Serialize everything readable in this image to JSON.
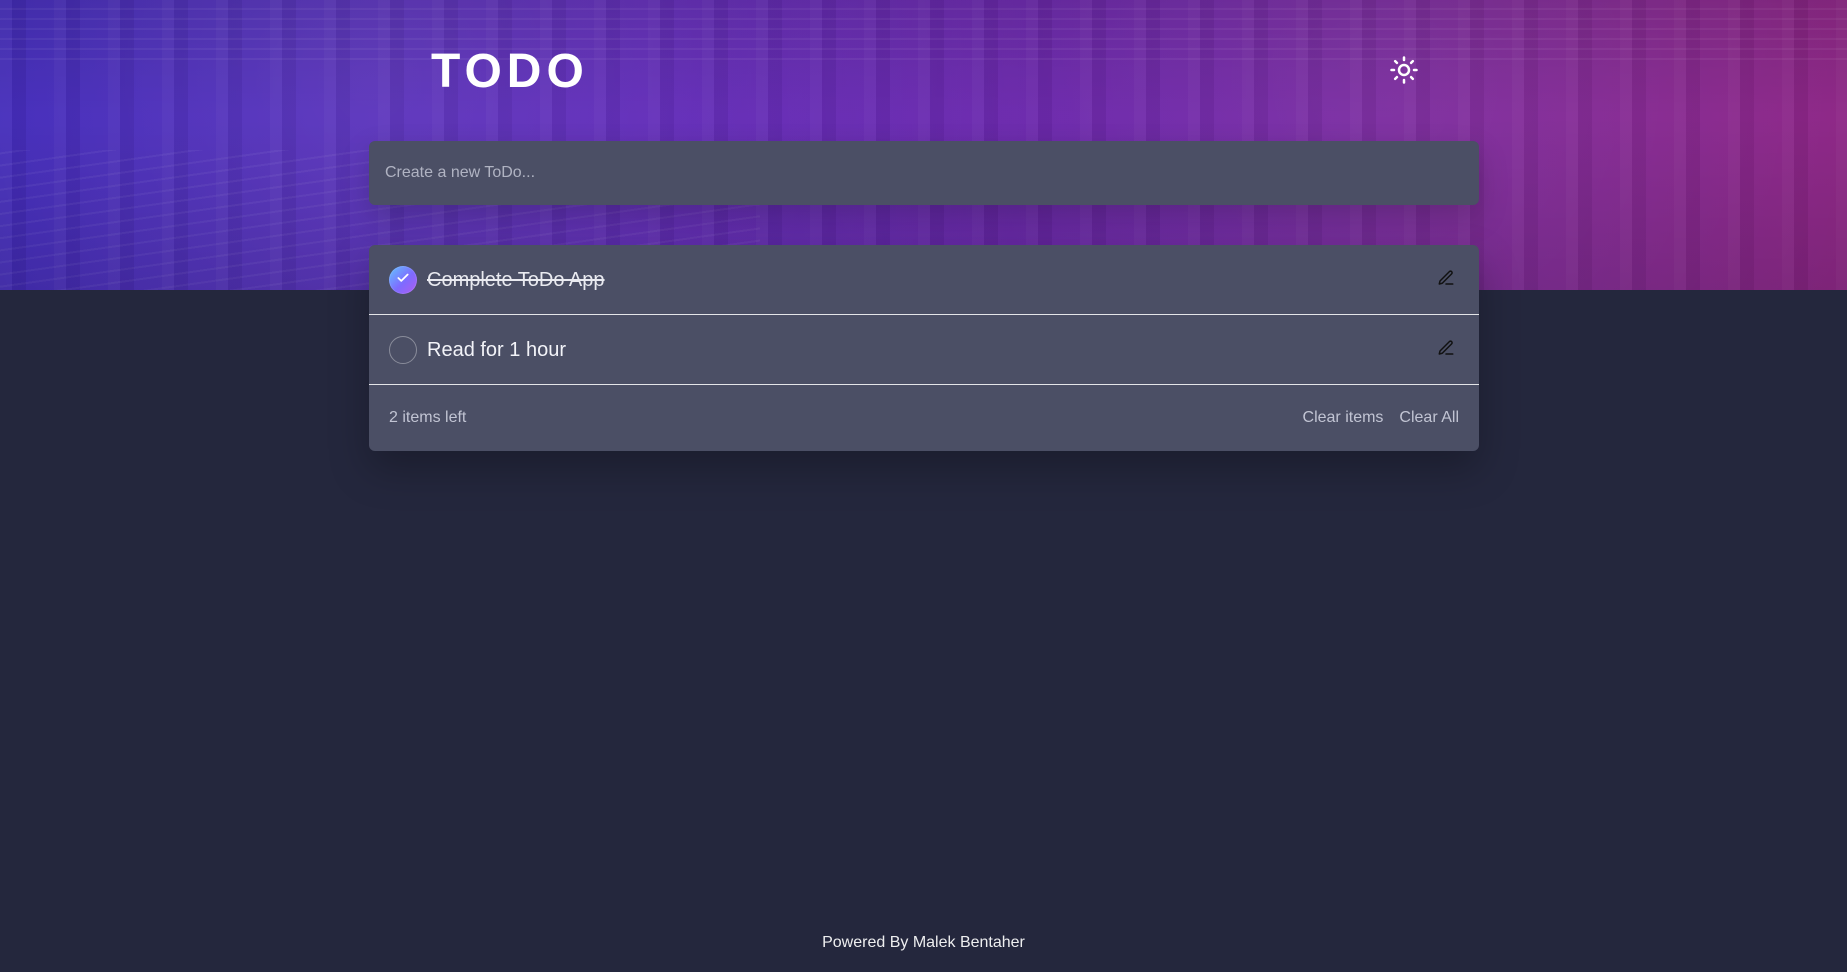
{
  "header": {
    "title": "TODO",
    "theme_icon": "sun-icon"
  },
  "new_todo": {
    "placeholder": "Create a new ToDo...",
    "value": ""
  },
  "todos": [
    {
      "text": "Complete ToDo App",
      "completed": true,
      "edit_icon": "pencil-icon"
    },
    {
      "text": "Read for 1 hour",
      "completed": false,
      "edit_icon": "pencil-icon"
    }
  ],
  "footer": {
    "items_left": "2 items left",
    "clear_items_label": "Clear items",
    "clear_all_label": "Clear All"
  },
  "powered_by": "Powered By Malek Bentaher",
  "colors": {
    "background": "#24273d",
    "card": "#4b4f65",
    "text": "#f2f3f8",
    "muted": "#d5d7e3",
    "hero_start": "#3b22b8",
    "hero_end": "#8a1f82",
    "check_gradient_start": "#63c5ff",
    "check_gradient_end": "#b05cf0"
  }
}
